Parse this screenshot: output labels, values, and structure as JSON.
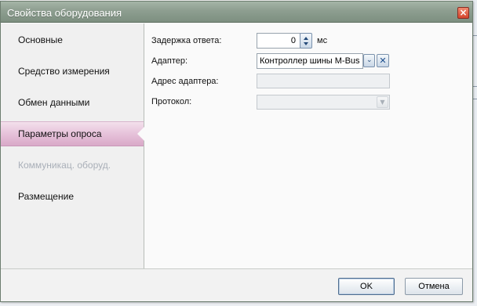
{
  "dialog": {
    "title": "Свойства оборудования",
    "close_glyph": "×"
  },
  "sidebar": {
    "items": [
      {
        "label": "Основные",
        "state": "normal"
      },
      {
        "label": "Средство измерения",
        "state": "normal"
      },
      {
        "label": "Обмен данными",
        "state": "normal"
      },
      {
        "label": "Параметры опроса",
        "state": "active"
      },
      {
        "label": "Коммуникац. оборуд.",
        "state": "disabled"
      },
      {
        "label": "Размещение",
        "state": "normal"
      }
    ]
  },
  "form": {
    "response_delay": {
      "label": "Задержка ответа:",
      "value": "0",
      "unit": "мс"
    },
    "adapter": {
      "label": "Адаптер:",
      "value": "Контроллер шины M-Bus"
    },
    "adapter_address": {
      "label": "Адрес адаптера:",
      "value": ""
    },
    "protocol": {
      "label": "Протокол:",
      "value": ""
    }
  },
  "footer": {
    "ok_label": "OK",
    "cancel_label": "Отмена"
  },
  "colors": {
    "titlebar": "#8d9e90",
    "active_item": "#e6c2da",
    "disabled_text": "#a9afb8"
  }
}
